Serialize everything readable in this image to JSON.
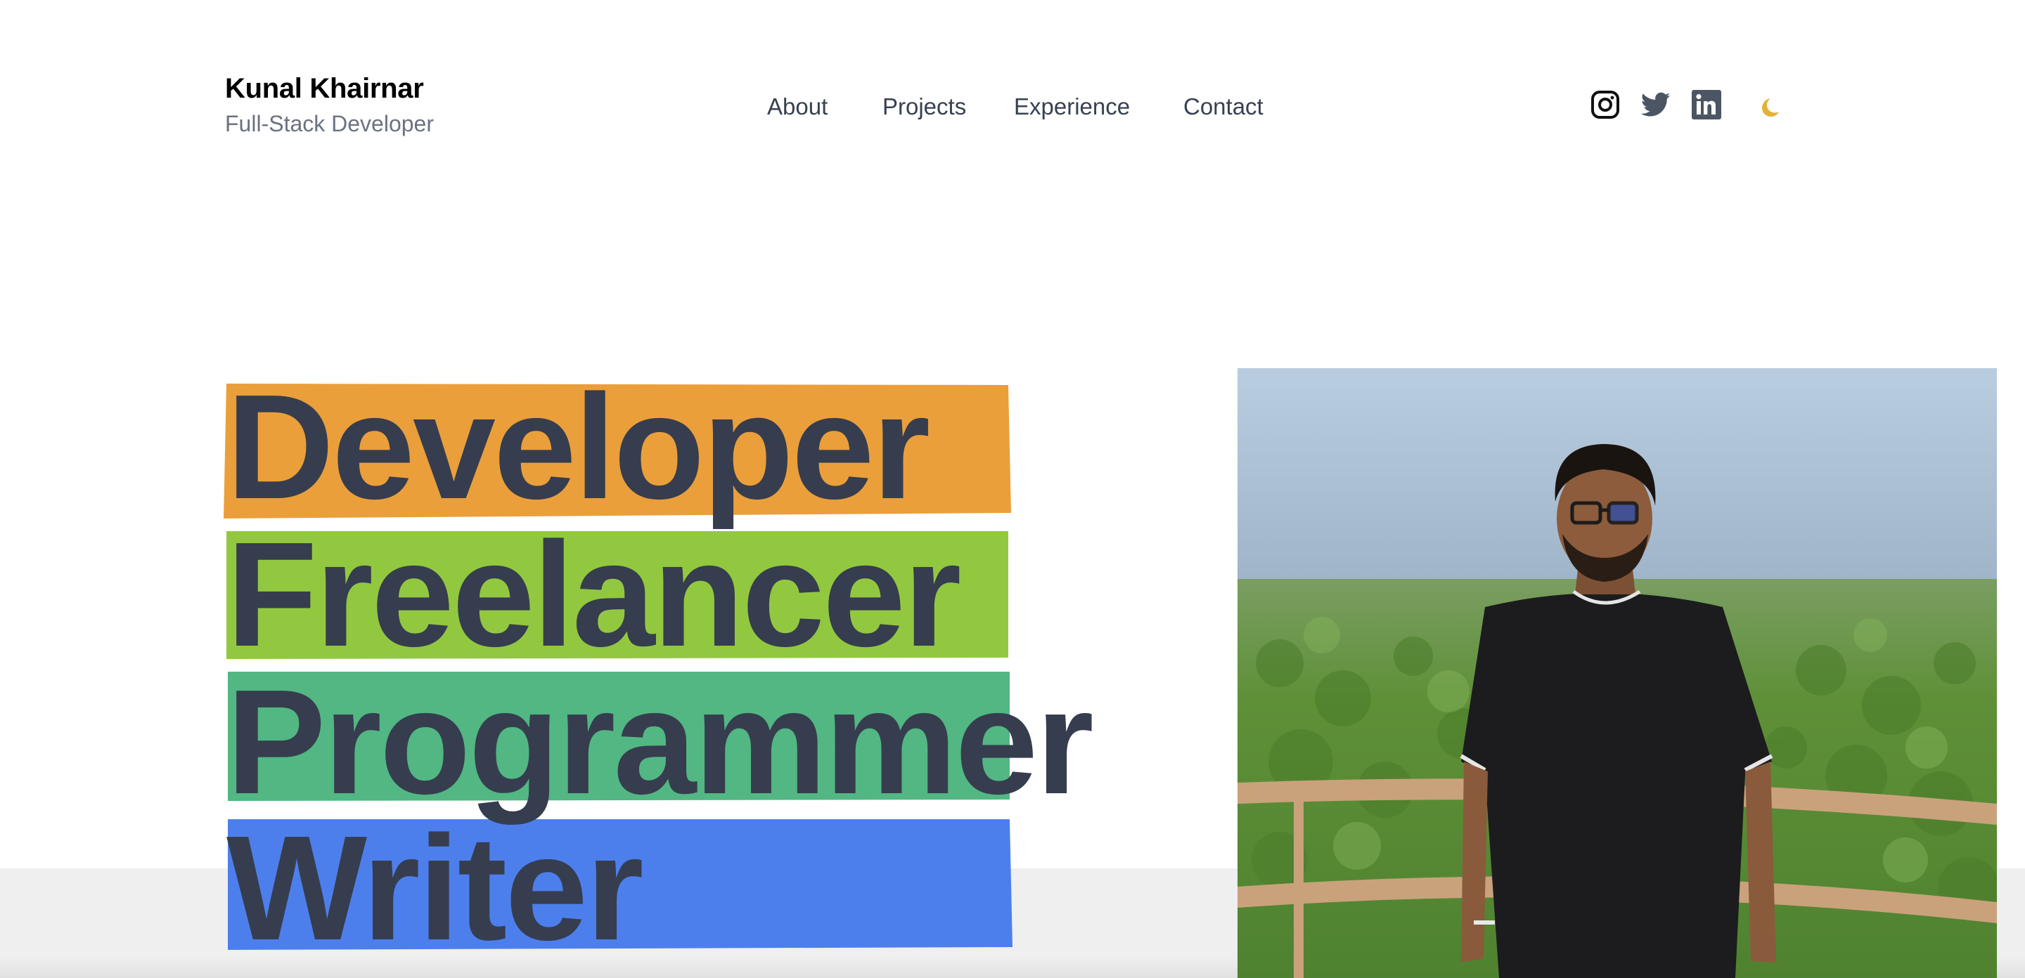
{
  "header": {
    "brand_name": "Kunal Khairnar",
    "brand_subtitle": "Full-Stack Developer",
    "nav": [
      {
        "label": "About"
      },
      {
        "label": "Projects"
      },
      {
        "label": "Experience"
      },
      {
        "label": "Contact"
      }
    ],
    "socials": [
      {
        "icon": "instagram-icon"
      },
      {
        "icon": "twitter-icon"
      },
      {
        "icon": "linkedin-icon"
      }
    ],
    "theme_toggle_icon": "moon-icon"
  },
  "hero": {
    "words": [
      {
        "text": "Developer",
        "highlight": "#ea9f3b"
      },
      {
        "text": "Freelancer",
        "highlight": "#92c840"
      },
      {
        "text": "Programmer",
        "highlight": "#52b783"
      },
      {
        "text": "Writer",
        "highlight": "#4d7fec"
      }
    ],
    "text_color": "#363d4e"
  },
  "colors": {
    "moon": "#e2b23a",
    "icon": "#4b5563",
    "bottom_band": "#efefef"
  }
}
